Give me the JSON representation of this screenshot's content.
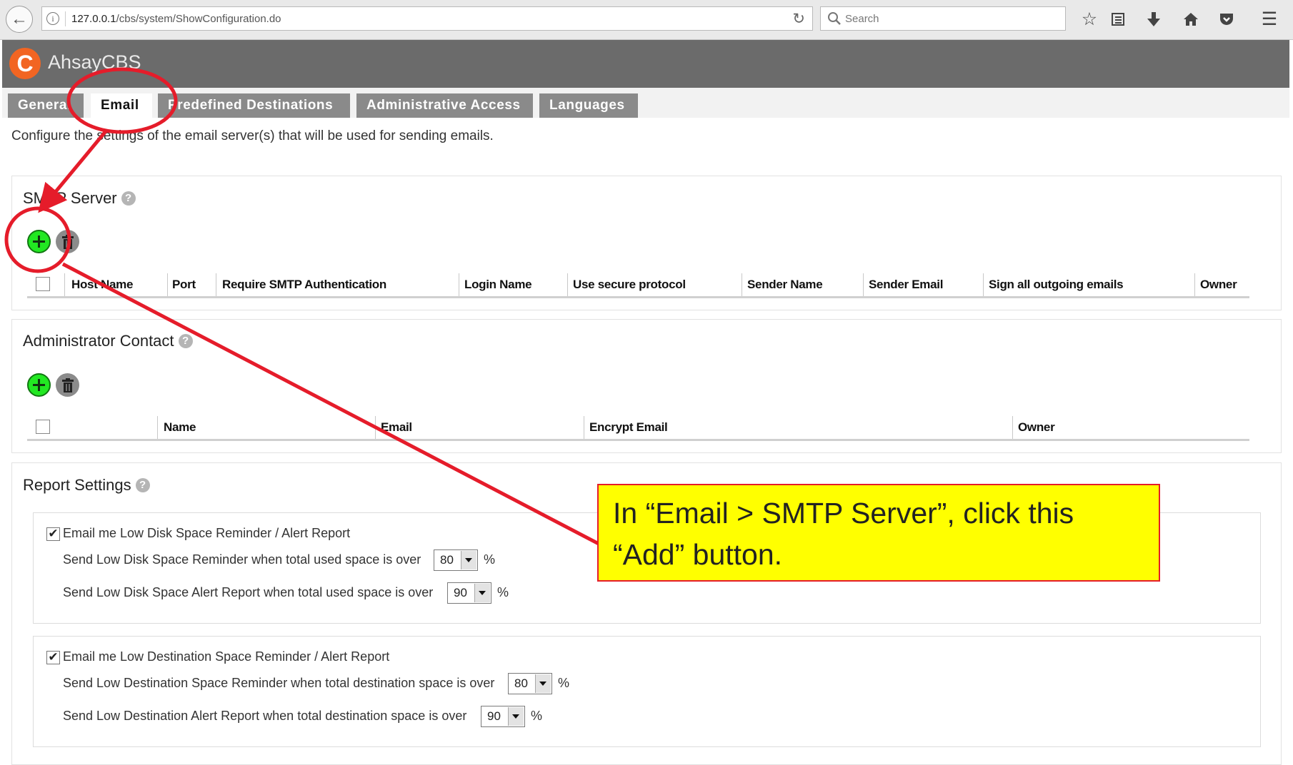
{
  "browser": {
    "url_host": "127.0.0.1",
    "url_path": "/cbs/system/ShowConfiguration.do",
    "search_placeholder": "Search"
  },
  "app": {
    "brand": "AhsayCBS",
    "logo_letter": "C",
    "brand_color": "#f26522"
  },
  "tabs": [
    {
      "label": "General"
    },
    {
      "label": "Email",
      "active": true
    },
    {
      "label": "Predefined Destinations"
    },
    {
      "label": "Administrative Access"
    },
    {
      "label": "Languages"
    }
  ],
  "intro_text": "Configure the settings of the email server(s) that will be used for sending emails.",
  "smtp": {
    "title": "SMTP Server",
    "columns": [
      "Host Name",
      "Port",
      "Require SMTP Authentication",
      "Login Name",
      "Use secure protocol",
      "Sender Name",
      "Sender Email",
      "Sign all outgoing emails",
      "Owner"
    ]
  },
  "admin_contact": {
    "title": "Administrator Contact",
    "columns": [
      "Name",
      "Email",
      "Encrypt Email",
      "Owner"
    ]
  },
  "report": {
    "title": "Report Settings",
    "disk": {
      "label": "Email me Low Disk Space Reminder / Alert Report",
      "checked": true,
      "reminder_label": "Send Low Disk Space Reminder when total used space is over",
      "reminder_value": "80",
      "alert_label": "Send Low Disk Space Alert Report when total used space is over",
      "alert_value": "90",
      "unit": "%"
    },
    "destination": {
      "label": "Email me Low Destination Space Reminder / Alert Report",
      "checked": true,
      "reminder_label": "Send Low Destination Space Reminder when total destination space is over",
      "reminder_value": "80",
      "alert_label": "Send Low Destination Alert Report when total destination space is over",
      "alert_value": "90",
      "unit": "%"
    }
  },
  "annotation": {
    "line1": "In “Email > SMTP Server”, click this",
    "line2": "“Add” button.",
    "color": "#e51c2a",
    "fill": "#ffff00"
  }
}
